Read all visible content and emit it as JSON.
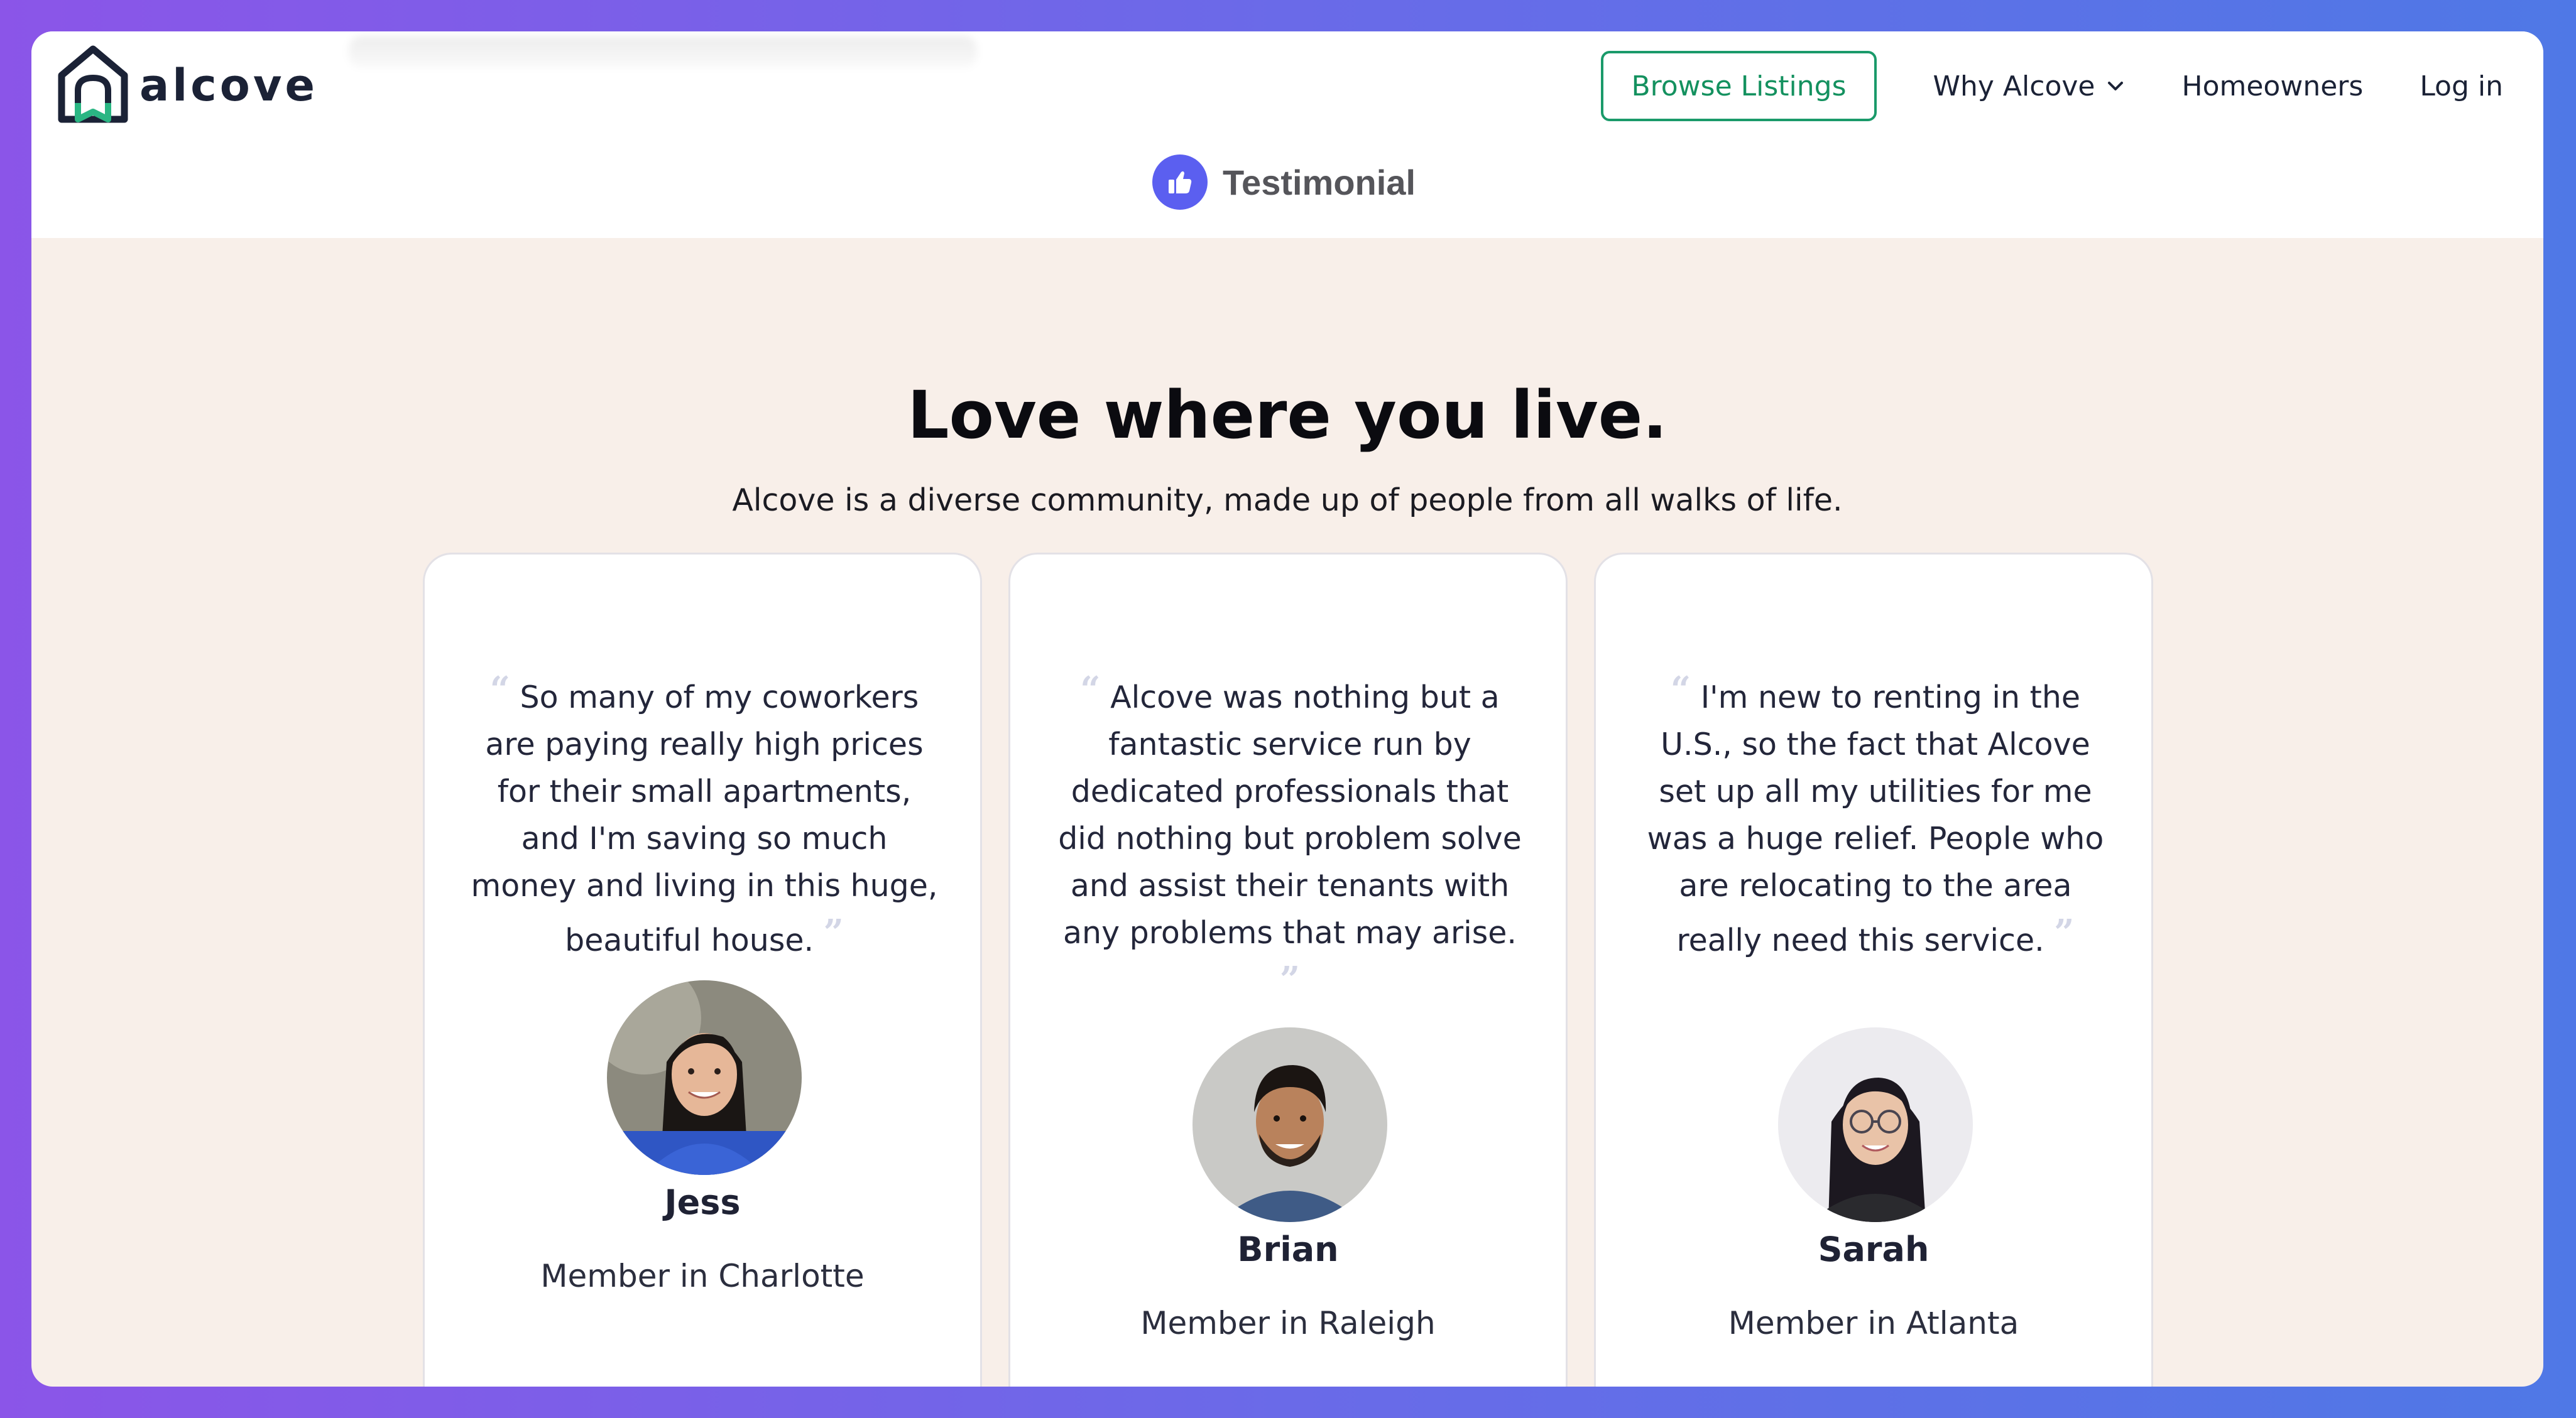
{
  "brand": {
    "name": "alcove",
    "accent": "#1a9a6a",
    "dark": "#1b2236"
  },
  "nav": {
    "browse_label": "Browse Listings",
    "why_label": "Why Alcove",
    "homeowners_label": "Homeowners",
    "login_label": "Log in"
  },
  "section_badge": {
    "label": "Testimonial",
    "icon": "thumbs-up-icon",
    "color": "#5b5ff0"
  },
  "main": {
    "heading": "Love where you live.",
    "subheading": "Alcove is a diverse community, made up of people from all walks of life."
  },
  "testimonials": [
    {
      "quote": "So many of my coworkers are paying really high prices for their small apartments, and I'm saving so much money and living in this huge, beautiful house.",
      "name": "Jess",
      "role": "Member in Charlotte"
    },
    {
      "quote": "Alcove was nothing but a fantastic service run by dedicated professionals that did nothing but problem solve and assist their tenants with any problems that may arise.",
      "name": "Brian",
      "role": "Member in Raleigh"
    },
    {
      "quote": "I'm new to renting in the U.S., so the fact that Alcove set up all my utilities for me was a huge relief. People who are relocating to the area really need this service.",
      "name": "Sarah",
      "role": "Member in Atlanta"
    }
  ]
}
